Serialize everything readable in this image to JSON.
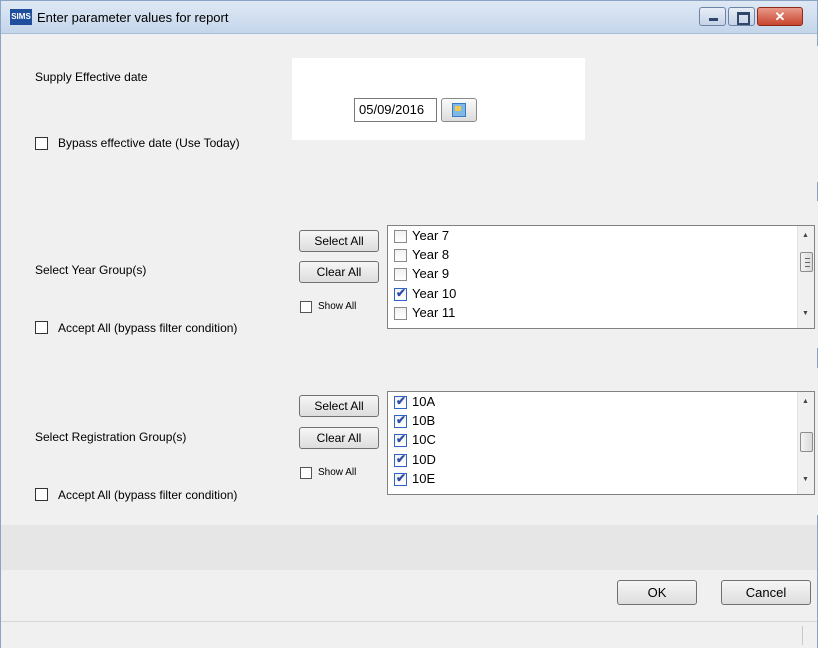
{
  "window": {
    "app_icon_text": "SIMS",
    "title": "Enter parameter values for report",
    "close_glyph": "✕"
  },
  "effective_date": {
    "label": "Supply Effective date",
    "date_value": "05/09/2016",
    "calendar_icon": "calendar-icon",
    "bypass_label": "Bypass effective date (Use Today)",
    "bypass_checked": false
  },
  "year_groups": {
    "label": "Select Year Group(s)",
    "select_all_label": "Select All",
    "clear_all_label": "Clear All",
    "show_all_label": "Show All",
    "accept_all_label": "Accept All (bypass filter condition)",
    "items": [
      {
        "label": "Year  7",
        "checked": false
      },
      {
        "label": "Year  8",
        "checked": false
      },
      {
        "label": "Year  9",
        "checked": false
      },
      {
        "label": "Year 10",
        "checked": true
      },
      {
        "label": "Year 11",
        "checked": false
      }
    ]
  },
  "registration_groups": {
    "label": "Select Registration Group(s)",
    "select_all_label": "Select All",
    "clear_all_label": "Clear All",
    "show_all_label": "Show All",
    "accept_all_label": "Accept All (bypass filter condition)",
    "items": [
      {
        "label": "10A",
        "checked": true
      },
      {
        "label": "10B",
        "checked": true
      },
      {
        "label": "10C",
        "checked": true
      },
      {
        "label": "10D",
        "checked": true
      },
      {
        "label": "10E",
        "checked": true
      }
    ]
  },
  "buttons": {
    "ok_label": "OK",
    "cancel_label": "Cancel"
  },
  "glyphs": {
    "tick": "✔",
    "scroll_up": "▲",
    "scroll_down": "▼"
  }
}
